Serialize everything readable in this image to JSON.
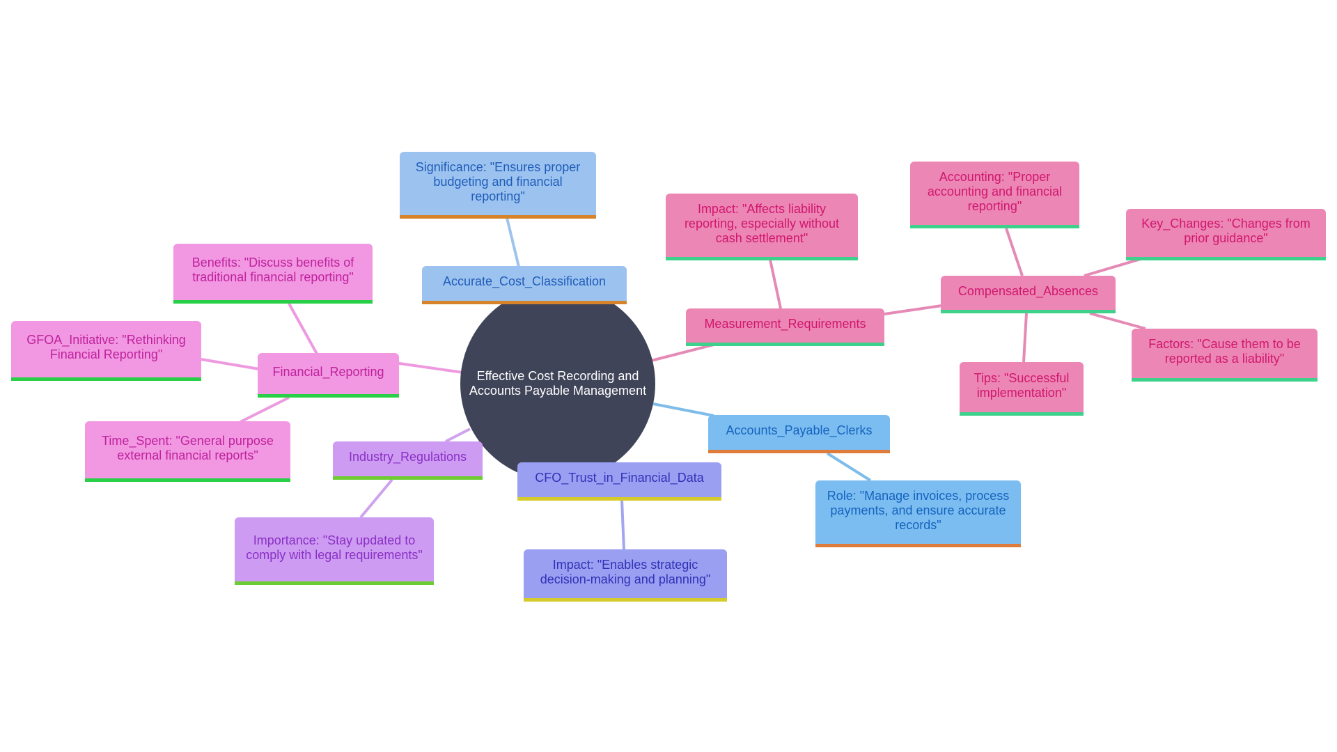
{
  "diagram": {
    "type": "mindmap",
    "root": "Effective Cost Recording and Accounts Payable Management",
    "branches": [
      {
        "id": "financial_reporting",
        "label": "Financial_Reporting",
        "color_scheme": {
          "fill": "#f297e2",
          "text": "#bf229c",
          "accent": "#29cf46",
          "edge": "#ed9ae0"
        },
        "children": [
          {
            "id": "benefits",
            "label": "Benefits: \"Discuss benefits of traditional financial reporting\""
          },
          {
            "id": "gfoa",
            "label": "GFOA_Initiative: \"Rethinking Financial Reporting\""
          },
          {
            "id": "time_spent",
            "label": "Time_Spent: \"General purpose external financial reports\""
          }
        ]
      },
      {
        "id": "accurate_cost",
        "label": "Accurate_Cost_Classification",
        "color_scheme": {
          "fill": "#9cc3f0",
          "text": "#1f5cb8",
          "accent": "#d6832c",
          "edge": "#9ec4ec"
        },
        "children": [
          {
            "id": "significance",
            "label": "Significance: \"Ensures proper budgeting and financial reporting\""
          }
        ]
      },
      {
        "id": "measurement",
        "label": "Measurement_Requirements",
        "color_scheme": {
          "fill": "#ec86b4",
          "text": "#d0176e",
          "accent": "#3dd18c",
          "edge": "#e58ab6"
        },
        "children": [
          {
            "id": "impact_meas",
            "label": "Impact: \"Affects liability reporting, especially without cash settlement\""
          },
          {
            "id": "compensated",
            "label": "Compensated_Absences",
            "children": [
              {
                "id": "accounting",
                "label": "Accounting: \"Proper accounting and financial reporting\""
              },
              {
                "id": "key_changes",
                "label": "Key_Changes: \"Changes from prior guidance\""
              },
              {
                "id": "factors",
                "label": "Factors: \"Cause them to be reported as a liability\""
              },
              {
                "id": "tips",
                "label": "Tips: \"Successful implementation\""
              }
            ]
          }
        ]
      },
      {
        "id": "apc",
        "label": "Accounts_Payable_Clerks",
        "color_scheme": {
          "fill": "#7cbdf1",
          "text": "#1463be",
          "accent": "#df7c3b",
          "edge": "#7ebde9"
        },
        "children": [
          {
            "id": "role",
            "label": "Role: \"Manage invoices, process payments, and ensure accurate records\""
          }
        ]
      },
      {
        "id": "cfo",
        "label": "CFO_Trust_in_Financial_Data",
        "color_scheme": {
          "fill": "#9b9ff2",
          "text": "#3131b6",
          "accent": "#d5cb2c",
          "edge": "#a3a6ef"
        },
        "children": [
          {
            "id": "impact_cfo",
            "label": "Impact: \"Enables strategic decision-making and planning\""
          }
        ]
      },
      {
        "id": "industry",
        "label": "Industry_Regulations",
        "color_scheme": {
          "fill": "#cd9bf1",
          "text": "#8a30c6",
          "accent": "#6ecb31",
          "edge": "#cfa2ee"
        },
        "children": [
          {
            "id": "importance",
            "label": "Importance: \"Stay updated to comply with legal requirements\""
          }
        ]
      }
    ]
  },
  "labels": {
    "root": "Effective Cost Recording and Accounts Payable Management",
    "financial_reporting": "Financial_Reporting",
    "benefits": "Benefits: \"Discuss benefits of traditional financial reporting\"",
    "gfoa": "GFOA_Initiative: \"Rethinking Financial Reporting\"",
    "time_spent": "Time_Spent: \"General purpose external financial reports\"",
    "accurate_cost": "Accurate_Cost_Classification",
    "significance": "Significance: \"Ensures proper budgeting and financial reporting\"",
    "measurement": "Measurement_Requirements",
    "impact_meas": "Impact: \"Affects liability reporting, especially without cash settlement\"",
    "compensated": "Compensated_Absences",
    "accounting": "Accounting: \"Proper accounting and financial reporting\"",
    "key_changes": "Key_Changes: \"Changes from prior guidance\"",
    "factors": "Factors: \"Cause them to be reported as a liability\"",
    "tips": "Tips: \"Successful implementation\"",
    "apc": "Accounts_Payable_Clerks",
    "role": "Role: \"Manage invoices, process payments, and ensure accurate records\"",
    "cfo": "CFO_Trust_in_Financial_Data",
    "impact_cfo": "Impact: \"Enables strategic decision-making and planning\"",
    "industry": "Industry_Regulations",
    "importance": "Importance: \"Stay updated to comply with legal requirements\""
  },
  "colors": {
    "root_fill": "#3f4459",
    "root_text": "#ffffff",
    "background": "#ffffff"
  }
}
